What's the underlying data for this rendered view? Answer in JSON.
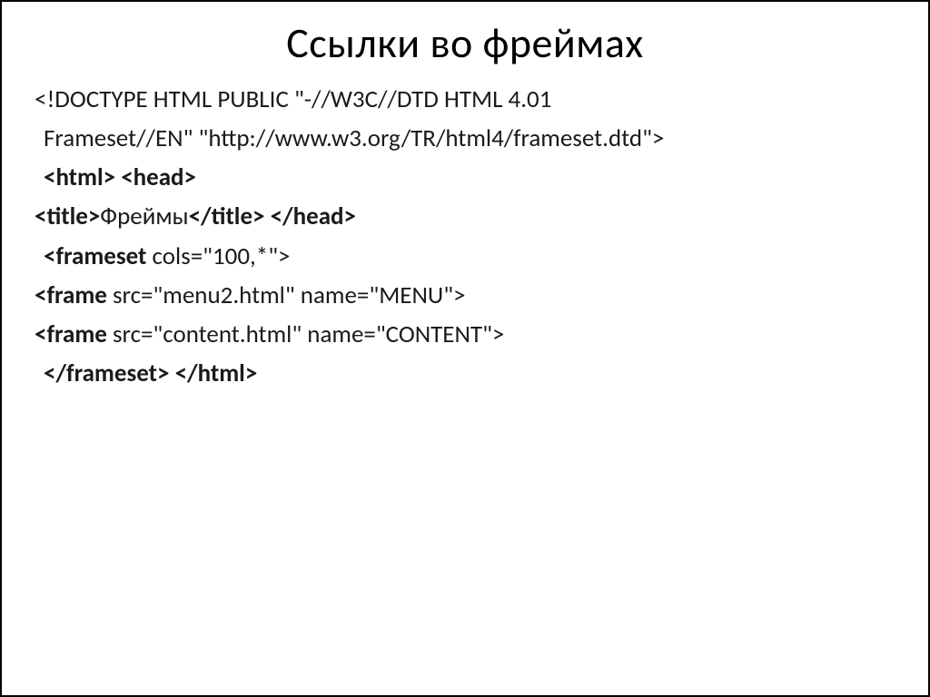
{
  "title": "Ссылки во фреймах",
  "lines": {
    "l1a": "<!DOCTYPE HTML PUBLIC \"-//W3C//DTD HTML 4.01",
    "l1b": "Frameset//EN\" \"http://www.w3.org/TR/html4/frameset.dtd\">",
    "l2": "<html> <head>",
    "l3a": "<title>",
    "l3b": "Фреймы",
    "l3c": "</title> </head>",
    "l4a": "<frameset",
    "l4b": " cols=\"100,*\">",
    "l5a": "<frame",
    "l5b": " src=\"menu2.html\" name=\"MENU\">",
    "l6a": "<frame",
    "l6b": " src=\"content.html\" name=\"CONTENT\">",
    "l7": "</frameset> </html>"
  }
}
